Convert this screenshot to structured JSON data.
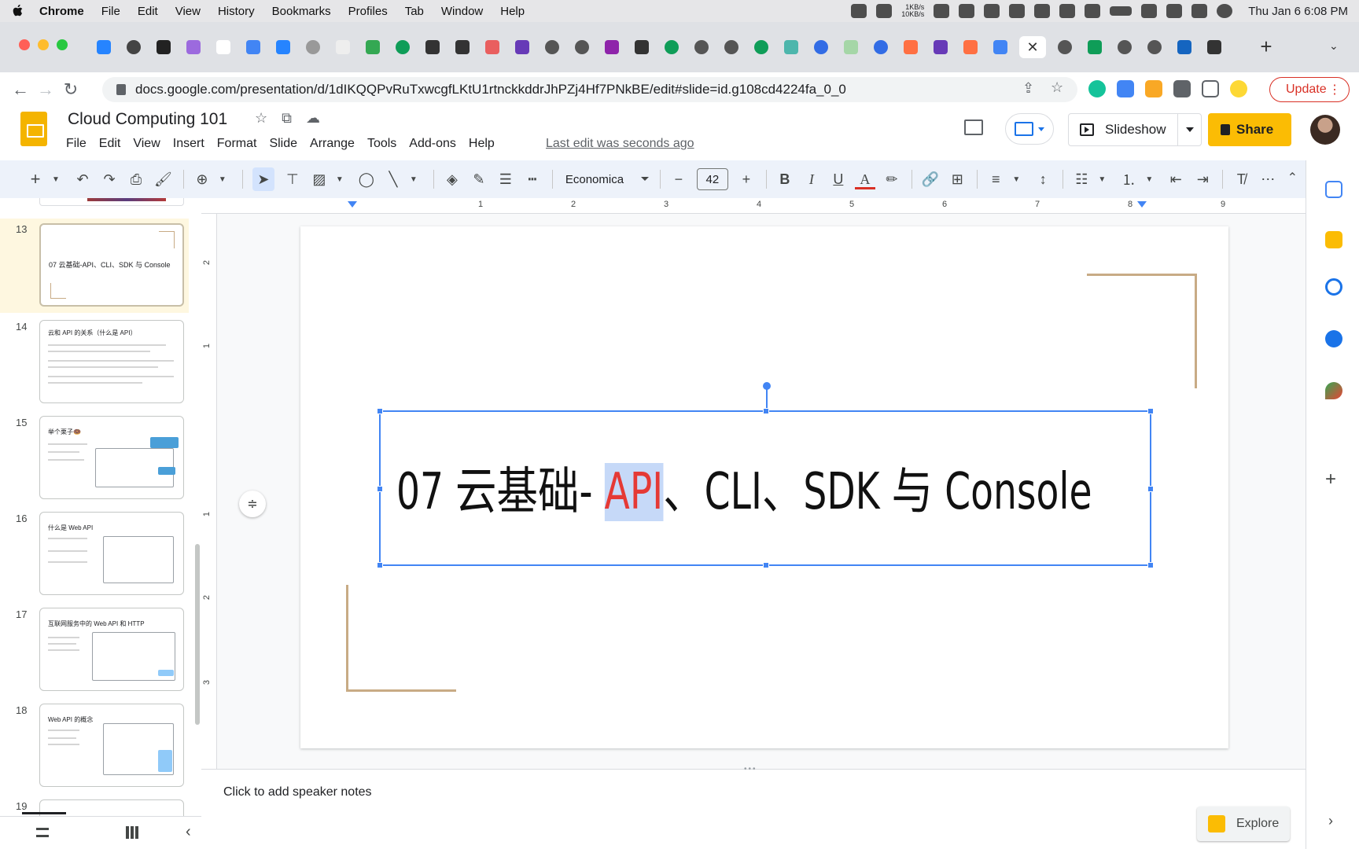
{
  "menubar": {
    "items": [
      "Chrome",
      "File",
      "Edit",
      "View",
      "History",
      "Bookmarks",
      "Profiles",
      "Tab",
      "Window",
      "Help"
    ],
    "net_up": "1KB/s",
    "net_down": "10KB/s",
    "clock": "Thu Jan 6  6:08 PM"
  },
  "browser": {
    "url": "docs.google.com/presentation/d/1dIKQQPvRuTxwcgfLKtU1rtnckkddrJhPZj4Hf7PNkBE/edit#slide=id.g108cd4224fa_0_0",
    "update_label": "Update"
  },
  "doc": {
    "title": "Cloud Computing 101",
    "menu": [
      "File",
      "Edit",
      "View",
      "Insert",
      "Format",
      "Slide",
      "Arrange",
      "Tools",
      "Add-ons",
      "Help"
    ],
    "last_edit": "Last edit was seconds ago",
    "slideshow_label": "Slideshow",
    "share_label": "Share"
  },
  "toolbar": {
    "font": "Economica",
    "font_size": "42"
  },
  "filmstrip": {
    "slides": [
      {
        "num": "13",
        "title": "07 云基础-API、CLI、SDK 与 Console"
      },
      {
        "num": "14",
        "title": "云和 API 的关系（什么是 API）"
      },
      {
        "num": "15",
        "title": "举个栗子🍩"
      },
      {
        "num": "16",
        "title": "什么是 Web API"
      },
      {
        "num": "17",
        "title": "互联网服务中的 Web API 和 HTTP"
      },
      {
        "num": "18",
        "title": "Web API 的概念"
      },
      {
        "num": "19",
        "title": ""
      }
    ]
  },
  "ruler": {
    "h_ticks": [
      "1",
      "2",
      "3",
      "4",
      "5",
      "6",
      "7",
      "8",
      "9"
    ],
    "v_ticks": [
      "2",
      "1",
      "1",
      "2",
      "3"
    ]
  },
  "slide": {
    "title_before": "07 云基础- ",
    "title_highlight": "API",
    "title_after": "、CLI、SDK 与 Console",
    "accent_color": "#c8ab85",
    "highlight_color": "#e53935"
  },
  "notes": {
    "placeholder": "Click to add speaker notes"
  },
  "explore": {
    "label": "Explore"
  }
}
